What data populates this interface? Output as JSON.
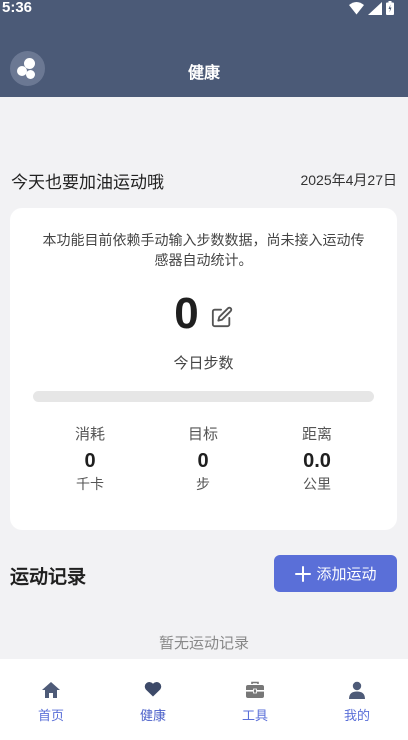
{
  "status_bar": {
    "time": "5:36"
  },
  "app_bar": {
    "title": "健康"
  },
  "greeting": {
    "text": "今天也要加油运动哦",
    "date": "2025年4月27日"
  },
  "steps_card": {
    "notice": "本功能目前依赖手动输入步数数据，尚未接入运动传感器自动统计。",
    "steps_value": "0",
    "steps_label": "今日步数",
    "progress_fraction": 0,
    "stats": [
      {
        "label": "消耗",
        "value": "0",
        "unit": "千卡"
      },
      {
        "label": "目标",
        "value": "0",
        "unit": "步"
      },
      {
        "label": "距离",
        "value": "0.0",
        "unit": "公里"
      }
    ]
  },
  "records": {
    "title": "运动记录",
    "add_button_label": "添加运动",
    "empty_text": "暂无运动记录"
  },
  "bottom_nav": {
    "items": [
      {
        "label": "首页",
        "icon": "home-icon",
        "active": false
      },
      {
        "label": "健康",
        "icon": "heart-icon",
        "active": true
      },
      {
        "label": "工具",
        "icon": "toolbox-icon",
        "active": false
      },
      {
        "label": "我的",
        "icon": "person-icon",
        "active": false
      }
    ]
  },
  "colors": {
    "header_bg": "#4b5a77",
    "accent": "#5a6fd8",
    "nav_active": "#4a5fc9",
    "nav_inactive": "#5a6fd8"
  }
}
